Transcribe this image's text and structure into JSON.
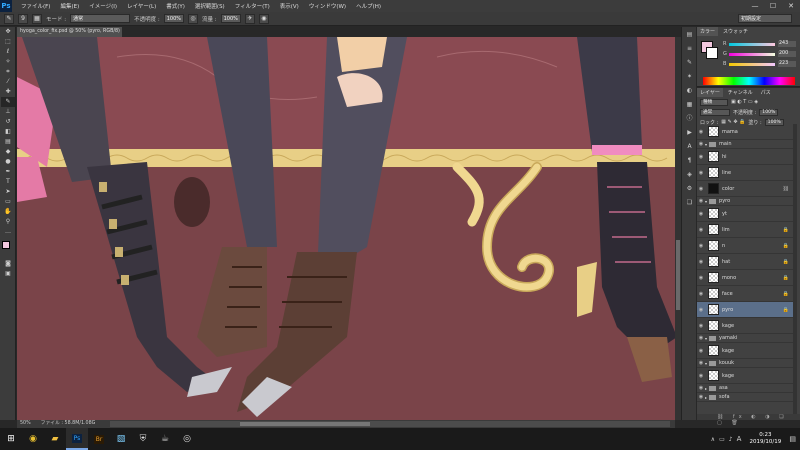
{
  "menubar": {
    "logo": "Ps",
    "items": [
      "ファイル(F)",
      "編集(E)",
      "イメージ(I)",
      "レイヤー(L)",
      "書式(Y)",
      "選択範囲(S)",
      "フィルター(T)",
      "表示(V)",
      "ウィンドウ(W)",
      "ヘルプ(H)"
    ],
    "window_controls": [
      "—",
      "☐",
      "✕"
    ]
  },
  "options": {
    "brush_size": "9",
    "mode_label": "モード :",
    "mode_value": "通常",
    "opacity_label": "不透明度 :",
    "opacity_value": "100%",
    "flow_label": "流量 :",
    "flow_value": "100%",
    "workspace": "初期設定"
  },
  "document": {
    "tab_title": "hyoga_color_fix.psd @ 50% (pyro, RGB/8) ×",
    "zoom": "50%",
    "file_info": "ファイル : 58.8M/1.08G"
  },
  "color_panel": {
    "tabs": [
      "カラー",
      "スウォッチ"
    ],
    "r_label": "R",
    "r_value": "243",
    "g_label": "G",
    "g_value": "200",
    "b_label": "B",
    "b_value": "223",
    "color_hex": "#f3c8df"
  },
  "layers_panel": {
    "tabs": [
      "レイヤー",
      "チャンネル",
      "パス"
    ],
    "filter_label": "種類",
    "blend_mode": "通常",
    "opacity_label": "不透明度 :",
    "opacity_value": "100%",
    "lock_label": "ロック :",
    "fill_label": "塗り :",
    "fill_value": "100%",
    "layers": [
      {
        "name": "mama",
        "type": "layer"
      },
      {
        "name": "main",
        "type": "group"
      },
      {
        "name": "hi",
        "type": "layer"
      },
      {
        "name": "line",
        "type": "layer"
      },
      {
        "name": "color",
        "type": "layer"
      },
      {
        "name": "pyro",
        "type": "group"
      },
      {
        "name": "yt",
        "type": "layer"
      },
      {
        "name": "lim",
        "type": "layer"
      },
      {
        "name": "n",
        "type": "layer"
      },
      {
        "name": "hat",
        "type": "layer"
      },
      {
        "name": "mono",
        "type": "layer"
      },
      {
        "name": "face",
        "type": "layer"
      },
      {
        "name": "pyro",
        "type": "layer",
        "selected": true
      },
      {
        "name": "kage",
        "type": "layer"
      },
      {
        "name": "yamaki",
        "type": "group"
      },
      {
        "name": "kage",
        "type": "layer"
      },
      {
        "name": "kouuk",
        "type": "group"
      },
      {
        "name": "kage",
        "type": "layer"
      },
      {
        "name": "asa",
        "type": "group"
      },
      {
        "name": "sofa",
        "type": "group"
      }
    ]
  },
  "taskbar": {
    "time": "0:23",
    "date": "2019/10/19",
    "ime": "A"
  }
}
